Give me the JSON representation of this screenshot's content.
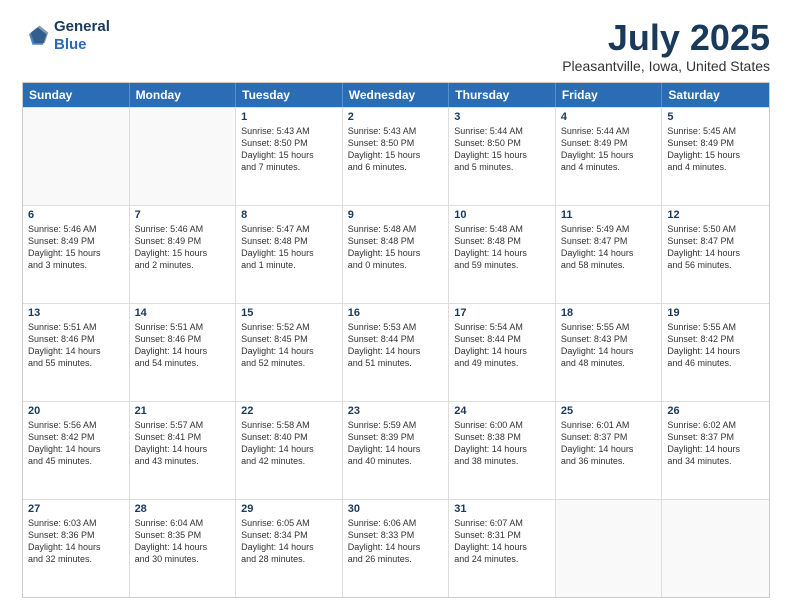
{
  "logo": {
    "line1": "General",
    "line2": "Blue"
  },
  "title": "July 2025",
  "location": "Pleasantville, Iowa, United States",
  "days": [
    "Sunday",
    "Monday",
    "Tuesday",
    "Wednesday",
    "Thursday",
    "Friday",
    "Saturday"
  ],
  "weeks": [
    [
      {
        "day": "",
        "content": ""
      },
      {
        "day": "",
        "content": ""
      },
      {
        "day": "1",
        "content": "Sunrise: 5:43 AM\nSunset: 8:50 PM\nDaylight: 15 hours\nand 7 minutes."
      },
      {
        "day": "2",
        "content": "Sunrise: 5:43 AM\nSunset: 8:50 PM\nDaylight: 15 hours\nand 6 minutes."
      },
      {
        "day": "3",
        "content": "Sunrise: 5:44 AM\nSunset: 8:50 PM\nDaylight: 15 hours\nand 5 minutes."
      },
      {
        "day": "4",
        "content": "Sunrise: 5:44 AM\nSunset: 8:49 PM\nDaylight: 15 hours\nand 4 minutes."
      },
      {
        "day": "5",
        "content": "Sunrise: 5:45 AM\nSunset: 8:49 PM\nDaylight: 15 hours\nand 4 minutes."
      }
    ],
    [
      {
        "day": "6",
        "content": "Sunrise: 5:46 AM\nSunset: 8:49 PM\nDaylight: 15 hours\nand 3 minutes."
      },
      {
        "day": "7",
        "content": "Sunrise: 5:46 AM\nSunset: 8:49 PM\nDaylight: 15 hours\nand 2 minutes."
      },
      {
        "day": "8",
        "content": "Sunrise: 5:47 AM\nSunset: 8:48 PM\nDaylight: 15 hours\nand 1 minute."
      },
      {
        "day": "9",
        "content": "Sunrise: 5:48 AM\nSunset: 8:48 PM\nDaylight: 15 hours\nand 0 minutes."
      },
      {
        "day": "10",
        "content": "Sunrise: 5:48 AM\nSunset: 8:48 PM\nDaylight: 14 hours\nand 59 minutes."
      },
      {
        "day": "11",
        "content": "Sunrise: 5:49 AM\nSunset: 8:47 PM\nDaylight: 14 hours\nand 58 minutes."
      },
      {
        "day": "12",
        "content": "Sunrise: 5:50 AM\nSunset: 8:47 PM\nDaylight: 14 hours\nand 56 minutes."
      }
    ],
    [
      {
        "day": "13",
        "content": "Sunrise: 5:51 AM\nSunset: 8:46 PM\nDaylight: 14 hours\nand 55 minutes."
      },
      {
        "day": "14",
        "content": "Sunrise: 5:51 AM\nSunset: 8:46 PM\nDaylight: 14 hours\nand 54 minutes."
      },
      {
        "day": "15",
        "content": "Sunrise: 5:52 AM\nSunset: 8:45 PM\nDaylight: 14 hours\nand 52 minutes."
      },
      {
        "day": "16",
        "content": "Sunrise: 5:53 AM\nSunset: 8:44 PM\nDaylight: 14 hours\nand 51 minutes."
      },
      {
        "day": "17",
        "content": "Sunrise: 5:54 AM\nSunset: 8:44 PM\nDaylight: 14 hours\nand 49 minutes."
      },
      {
        "day": "18",
        "content": "Sunrise: 5:55 AM\nSunset: 8:43 PM\nDaylight: 14 hours\nand 48 minutes."
      },
      {
        "day": "19",
        "content": "Sunrise: 5:55 AM\nSunset: 8:42 PM\nDaylight: 14 hours\nand 46 minutes."
      }
    ],
    [
      {
        "day": "20",
        "content": "Sunrise: 5:56 AM\nSunset: 8:42 PM\nDaylight: 14 hours\nand 45 minutes."
      },
      {
        "day": "21",
        "content": "Sunrise: 5:57 AM\nSunset: 8:41 PM\nDaylight: 14 hours\nand 43 minutes."
      },
      {
        "day": "22",
        "content": "Sunrise: 5:58 AM\nSunset: 8:40 PM\nDaylight: 14 hours\nand 42 minutes."
      },
      {
        "day": "23",
        "content": "Sunrise: 5:59 AM\nSunset: 8:39 PM\nDaylight: 14 hours\nand 40 minutes."
      },
      {
        "day": "24",
        "content": "Sunrise: 6:00 AM\nSunset: 8:38 PM\nDaylight: 14 hours\nand 38 minutes."
      },
      {
        "day": "25",
        "content": "Sunrise: 6:01 AM\nSunset: 8:37 PM\nDaylight: 14 hours\nand 36 minutes."
      },
      {
        "day": "26",
        "content": "Sunrise: 6:02 AM\nSunset: 8:37 PM\nDaylight: 14 hours\nand 34 minutes."
      }
    ],
    [
      {
        "day": "27",
        "content": "Sunrise: 6:03 AM\nSunset: 8:36 PM\nDaylight: 14 hours\nand 32 minutes."
      },
      {
        "day": "28",
        "content": "Sunrise: 6:04 AM\nSunset: 8:35 PM\nDaylight: 14 hours\nand 30 minutes."
      },
      {
        "day": "29",
        "content": "Sunrise: 6:05 AM\nSunset: 8:34 PM\nDaylight: 14 hours\nand 28 minutes."
      },
      {
        "day": "30",
        "content": "Sunrise: 6:06 AM\nSunset: 8:33 PM\nDaylight: 14 hours\nand 26 minutes."
      },
      {
        "day": "31",
        "content": "Sunrise: 6:07 AM\nSunset: 8:31 PM\nDaylight: 14 hours\nand 24 minutes."
      },
      {
        "day": "",
        "content": ""
      },
      {
        "day": "",
        "content": ""
      }
    ]
  ]
}
